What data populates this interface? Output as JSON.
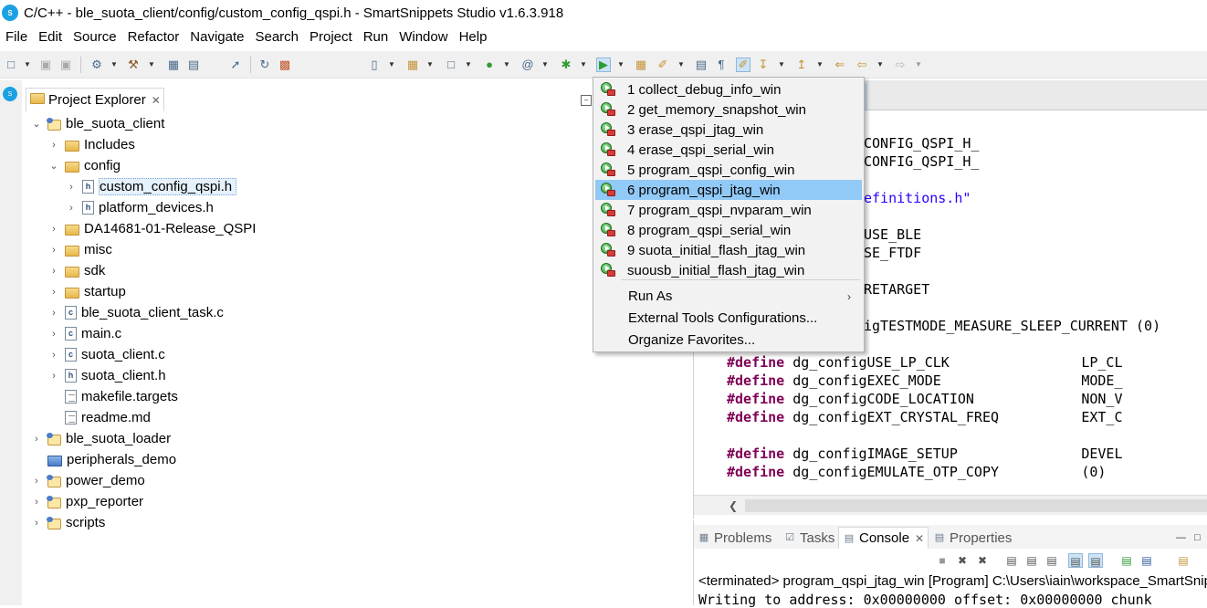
{
  "window": {
    "title": "C/C++ - ble_suota_client/config/custom_config_qspi.h - SmartSnippets Studio v1.6.3.918",
    "logo_text": "S"
  },
  "menubar": [
    "File",
    "Edit",
    "Source",
    "Refactor",
    "Navigate",
    "Search",
    "Project",
    "Run",
    "Window",
    "Help"
  ],
  "project_explorer": {
    "tab_label": "Project Explorer",
    "tree": [
      {
        "label": "ble_suota_client",
        "icon": "project-icon",
        "expanded": true
      },
      {
        "label": "Includes",
        "icon": "includes-folder-icon"
      },
      {
        "label": "config",
        "icon": "folder-open-icon",
        "expanded": true
      },
      {
        "label": "custom_config_qspi.h",
        "icon": "header-file-icon",
        "selected": true
      },
      {
        "label": "platform_devices.h",
        "icon": "header-file-icon"
      },
      {
        "label": "DA14681-01-Release_QSPI",
        "icon": "folder-icon"
      },
      {
        "label": "misc",
        "icon": "folder-icon"
      },
      {
        "label": "sdk",
        "icon": "folder-icon"
      },
      {
        "label": "startup",
        "icon": "folder-icon"
      },
      {
        "label": "ble_suota_client_task.c",
        "icon": "c-file-icon"
      },
      {
        "label": "main.c",
        "icon": "c-file-icon"
      },
      {
        "label": "suota_client.c",
        "icon": "c-file-icon"
      },
      {
        "label": "suota_client.h",
        "icon": "header-file-icon"
      },
      {
        "label": "makefile.targets",
        "icon": "text-file-icon"
      },
      {
        "label": "readme.md",
        "icon": "text-file-icon"
      },
      {
        "label": "ble_suota_loader",
        "icon": "project-icon"
      },
      {
        "label": "peripherals_demo",
        "icon": "project-closed-icon"
      },
      {
        "label": "power_demo",
        "icon": "project-icon"
      },
      {
        "label": "pxp_reporter",
        "icon": "project-icon"
      },
      {
        "label": "scripts",
        "icon": "project-icon"
      }
    ]
  },
  "editor": {
    "lines": [
      {
        "pre": "",
        "text": "CONFIG_QSPI_H_"
      },
      {
        "pre": "",
        "text": "CONFIG_QSPI_H_"
      },
      {
        "pre": "",
        "text": "efinitions.h\""
      },
      {
        "pre": "",
        "text": "USE_BLE"
      },
      {
        "pre": "",
        "text": "SE_FTDF"
      },
      {
        "pre": "",
        "text": "RETARGET"
      },
      {
        "pre": "",
        "text": "igTESTMODE_MEASURE_SLEEP_CURRENT (0)"
      },
      {
        "pre": "#define",
        "text": " dg_configUSE_LP_CLK                LP_CL"
      },
      {
        "pre": "#define",
        "text": " dg_configEXEC_MODE                 MODE_"
      },
      {
        "pre": "#define",
        "text": " dg_configCODE_LOCATION             NON_V"
      },
      {
        "pre": "#define",
        "text": " dg_configEXT_CRYSTAL_FREQ          EXT_C"
      },
      {
        "pre": "#define",
        "text": " dg_configIMAGE_SETUP               DEVEL"
      },
      {
        "pre": "#define",
        "text": " dg_configEMULATE_OTP_COPY          (0)"
      }
    ]
  },
  "console": {
    "tabs": [
      "Problems",
      "Tasks",
      "Console",
      "Properties"
    ],
    "active_tab": "Console",
    "line1": "<terminated> program_qspi_jtag_win [Program] C:\\Users\\iain\\workspace_SmartSnip",
    "line2": "Writing to address: 0x00000000 offset: 0x00000000 chunk"
  },
  "dropdown": {
    "items": [
      "1 collect_debug_info_win",
      "2 get_memory_snapshot_win",
      "3 erase_qspi_jtag_win",
      "4 erase_qspi_serial_win",
      "5 program_qspi_config_win",
      "6 program_qspi_jtag_win",
      "7 program_qspi_nvparam_win",
      "8 program_qspi_serial_win",
      "9 suota_initial_flash_jtag_win",
      "suousb_initial_flash_jtag_win"
    ],
    "highlighted_index": 5,
    "run_as": "Run As",
    "external_tools": "External Tools Configurations...",
    "organize": "Organize Favorites...",
    "submenu_arrow": "›"
  }
}
